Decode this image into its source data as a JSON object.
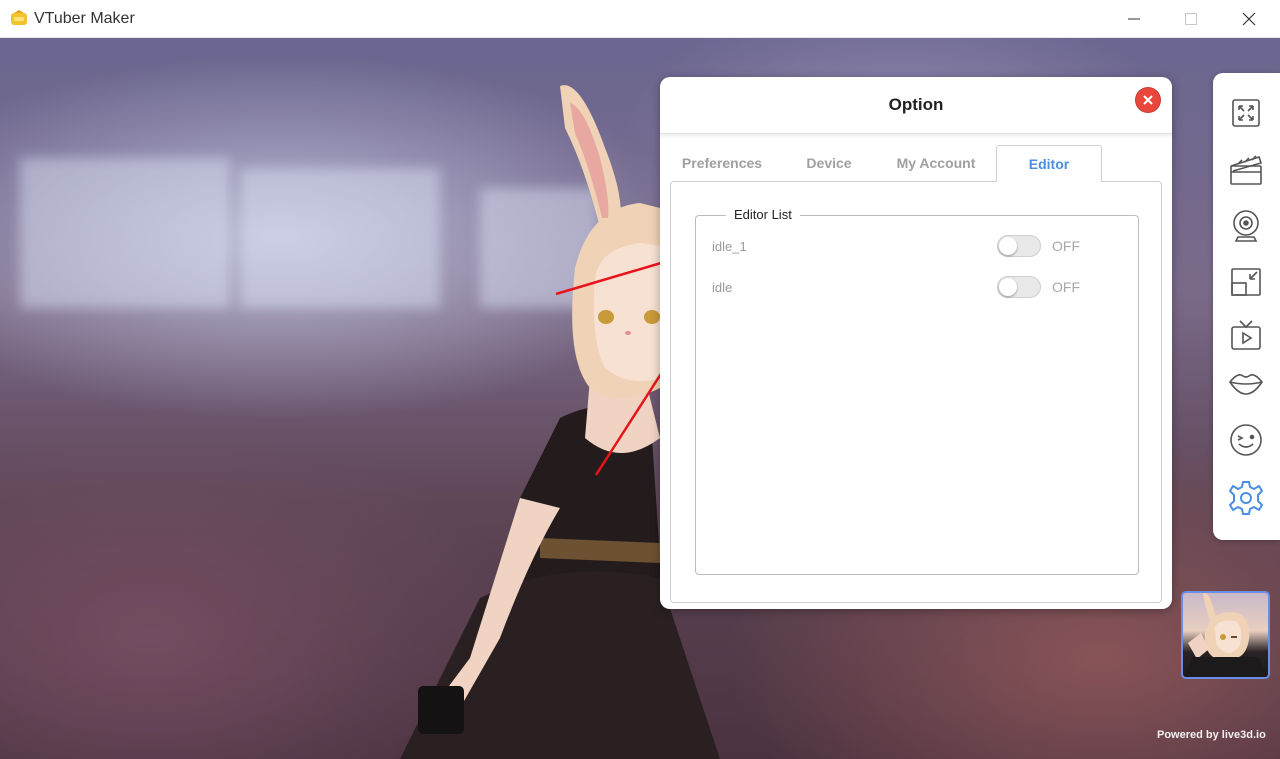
{
  "app": {
    "title": "VTuber Maker"
  },
  "dialog": {
    "title": "Option",
    "tabs": [
      {
        "label": "Preferences"
      },
      {
        "label": "Device"
      },
      {
        "label": "My Account"
      },
      {
        "label": "Editor"
      }
    ],
    "active_tab": "Editor",
    "editor_list": {
      "legend": "Editor List",
      "items": [
        {
          "name": "idle_1",
          "state": "OFF"
        },
        {
          "name": "idle",
          "state": "OFF"
        }
      ]
    }
  },
  "sidebar": {
    "icons": [
      "fullscreen-icon",
      "clapperboard-icon",
      "webcam-icon",
      "resize-window-icon",
      "tv-play-icon",
      "lips-icon",
      "wink-face-icon",
      "gear-icon"
    ],
    "active_icon": "gear-icon",
    "active_color": "#4a8fe0"
  },
  "footer": {
    "powered_by": "Powered by live3d.io"
  },
  "colors": {
    "close": "#e9473b",
    "active_tab": "#4a8fe0",
    "annotation_arrow": "#e8141b"
  }
}
